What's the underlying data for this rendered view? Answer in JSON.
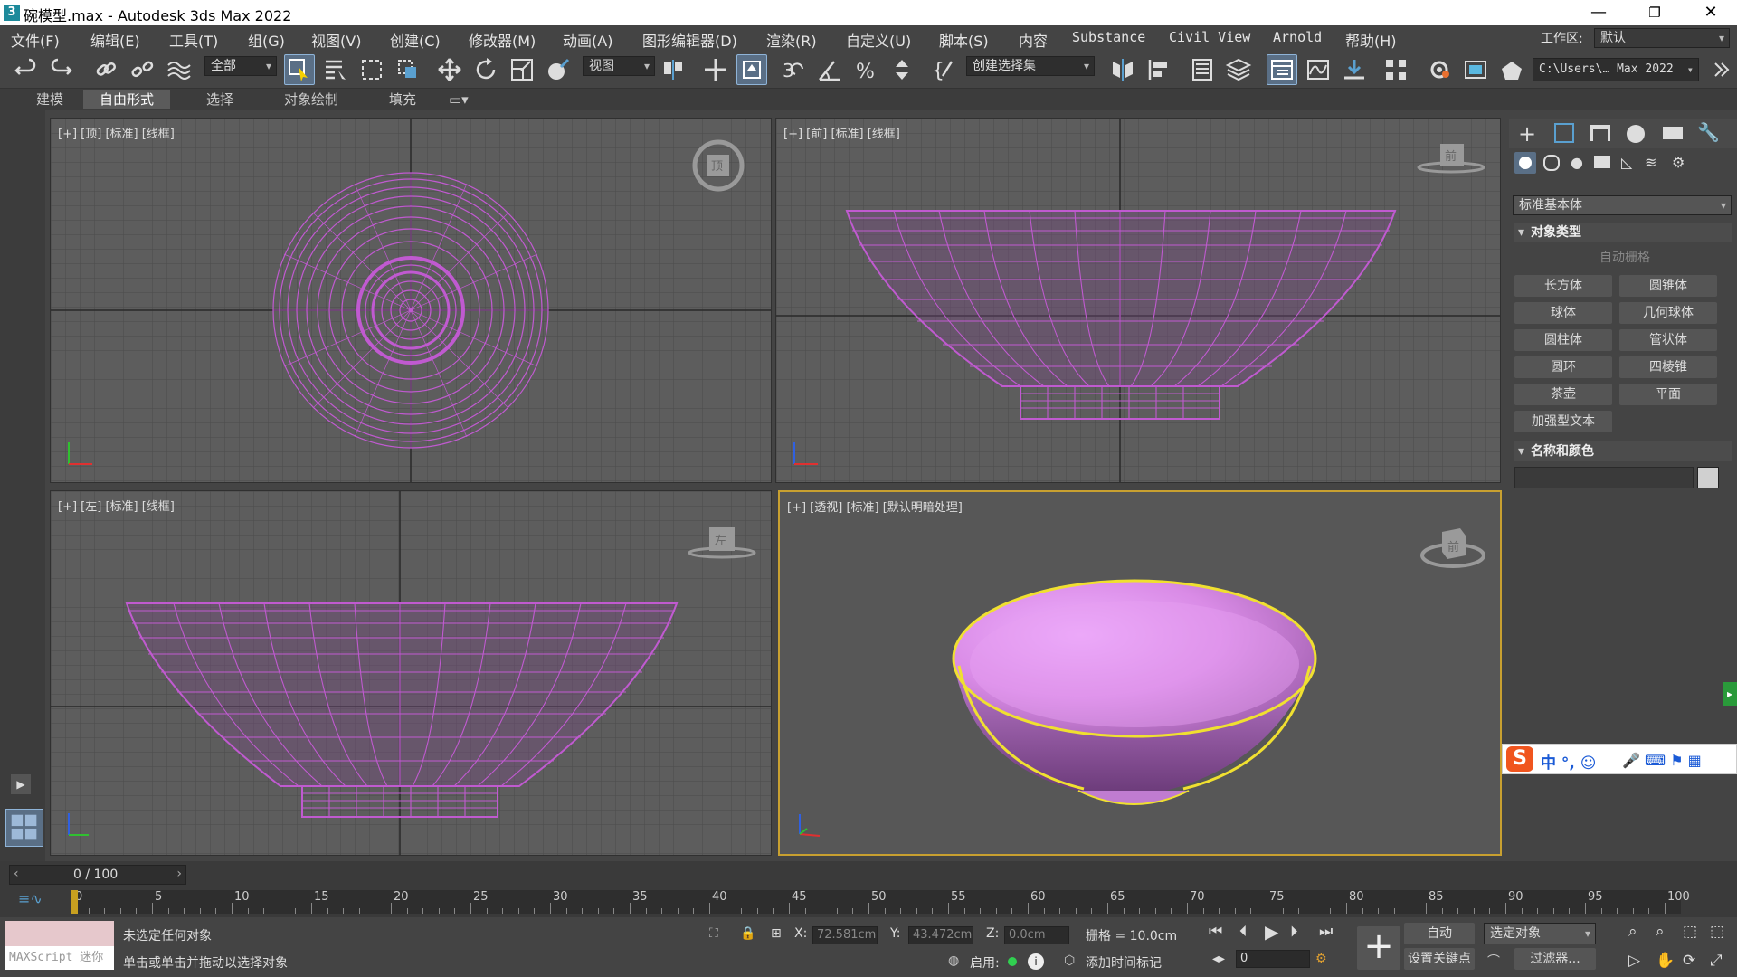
{
  "window": {
    "title": "碗模型.max - Autodesk 3ds Max 2022",
    "logo": "3",
    "min": "—",
    "max": "❐",
    "close": "✕"
  },
  "menu": [
    "文件(F)",
    "编辑(E)",
    "工具(T)",
    "组(G)",
    "视图(V)",
    "创建(C)",
    "修改器(M)",
    "动画(A)",
    "图形编辑器(D)",
    "渲染(R)",
    "自定义(U)",
    "脚本(S)",
    "内容",
    "Substance",
    "Civil View",
    "Arnold",
    "帮助(H)"
  ],
  "workspace": {
    "label": "工作区:",
    "value": "默认"
  },
  "toolbar": {
    "filter": "全部",
    "refcoord": "视图",
    "selset": "创建选择集",
    "path": "C:\\Users\\… Max 2022"
  },
  "ribbon": [
    "建模",
    "自由形式",
    "选择",
    "对象绘制",
    "填充"
  ],
  "viewports": {
    "top": "[+] [顶] [标准] [线框]",
    "front": "[+] [前] [标准] [线框]",
    "left": "[+] [左] [标准] [线框]",
    "persp": "[+] [透视] [标准] [默认明暗处理]"
  },
  "viewcube": {
    "top": "顶",
    "front": "前",
    "left": "左",
    "persp": "前"
  },
  "cmd": {
    "category": "标准基本体",
    "objtype": "对象类型",
    "autogrid": "自动栅格",
    "buttons": [
      "长方体",
      "圆锥体",
      "球体",
      "几何球体",
      "圆柱体",
      "管状体",
      "圆环",
      "四棱锥",
      "茶壶",
      "平面",
      "加强型文本"
    ],
    "namecolor": "名称和颜色",
    "color": "#d0d0d0"
  },
  "timeline": {
    "frame": "0 / 100",
    "ticks": [
      "0",
      "5",
      "10",
      "15",
      "20",
      "25",
      "30",
      "35",
      "40",
      "45",
      "50",
      "55",
      "60",
      "65",
      "70",
      "75",
      "80",
      "85",
      "90",
      "95",
      "100"
    ]
  },
  "status": {
    "maxscript": "MAXScript 迷你",
    "line1": "未选定任何对象",
    "line2": "单击或单击并拖动以选择对象",
    "x_label": "X:",
    "x": "72.581cm",
    "y_label": "Y:",
    "y": "43.472cm",
    "z_label": "Z:",
    "z": "0.0cm",
    "grid": "栅格 = 10.0cm",
    "enable": "启用:",
    "addtime": "添加时间标记",
    "auto": "自动",
    "setkey": "设置关键点",
    "selobj": "选定对象",
    "filters": "过滤器...",
    "frameval": "0"
  },
  "ime": {
    "text": "中 °, ☺"
  },
  "colors": {
    "wire": "#c05ad0",
    "bowl": "#d98be6",
    "accent": "#5a6f86",
    "select": "#f0e030"
  }
}
